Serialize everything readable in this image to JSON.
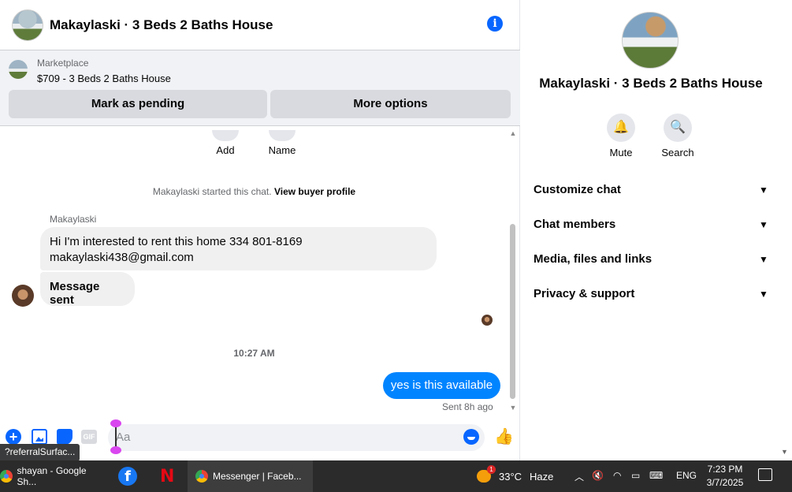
{
  "chat": {
    "title": "Makaylaski · 3 Beds 2 Baths House",
    "marketplace": {
      "label": "Marketplace",
      "listing": "$709 - 3 Beds 2 Baths House",
      "mark_pending": "Mark as pending",
      "more_options": "More options"
    },
    "quick_actions": {
      "add": "Add",
      "name": "Name"
    },
    "system_message_prefix": "Makaylaski started this chat.",
    "system_message_link": "View buyer profile",
    "sender_name": "Makaylaski",
    "messages": [
      {
        "line1": "Hi I'm interested to rent this home 334 801-8169",
        "line2": "makaylaski438@gmail.com"
      },
      {
        "text": "Message sent"
      }
    ],
    "timestamp": "10:27 AM",
    "my_message": "yes is this available",
    "sent_status": "Sent 8h ago",
    "composer": {
      "placeholder": "Aa",
      "gif_label": "GIF"
    },
    "tooltip": "?referralSurfac..."
  },
  "panel": {
    "title": "Makaylaski · 3 Beds 2 Baths House",
    "mute_label": "Mute",
    "search_label": "Search",
    "sections": [
      "Customize chat",
      "Chat members",
      "Media, files and links",
      "Privacy & support"
    ]
  },
  "taskbar": {
    "items": [
      {
        "label": "shayan - Google Sh..."
      },
      {
        "label": "Messenger | Faceb..."
      }
    ],
    "weather": {
      "temp": "33°C",
      "condition": "Haze",
      "badge": "1"
    },
    "language": "ENG",
    "time": "7:23 PM",
    "date": "3/7/2025"
  },
  "colors": {
    "accent": "#0866ff",
    "my_bubble": "#0084ff",
    "taskbar": "#2b2b2b"
  }
}
